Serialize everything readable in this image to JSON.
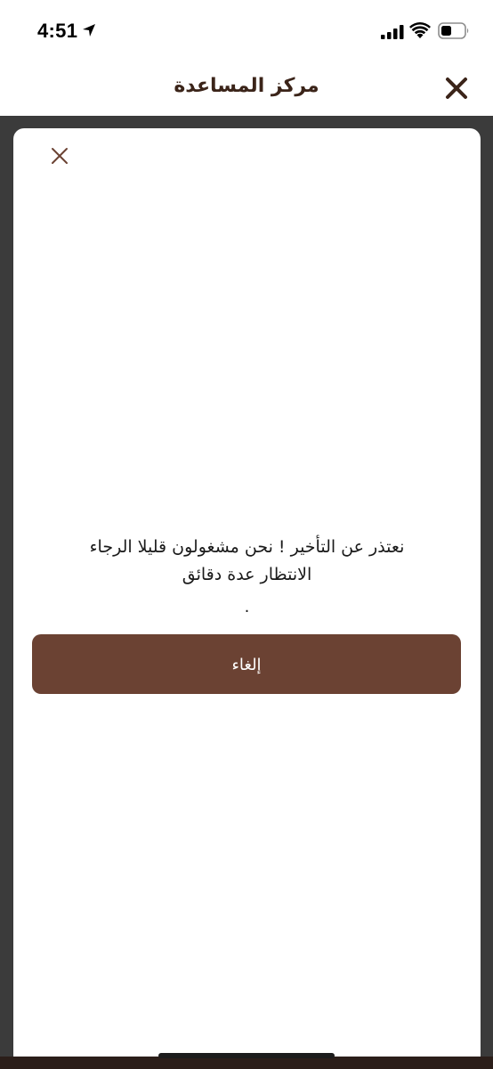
{
  "status_bar": {
    "time": "4:51",
    "location_icon": "location-arrow-icon",
    "signal_icon": "cellular-signal-icon",
    "wifi_icon": "wifi-icon",
    "battery_icon": "battery-icon"
  },
  "header": {
    "title": "مركز المساعدة",
    "close_icon": "close-icon"
  },
  "dialog": {
    "close_icon": "close-icon",
    "message_line1": "نعتذر عن التأخير ! نحن مشغولون قليلا الرجاء",
    "message_line2": "الانتظار عدة دقائق",
    "message_dot": ".",
    "cancel_label": "إلغاء"
  },
  "colors": {
    "brand_brown": "#6b4233",
    "title_color": "#3b2419",
    "overlay": "#3b3b3b"
  }
}
